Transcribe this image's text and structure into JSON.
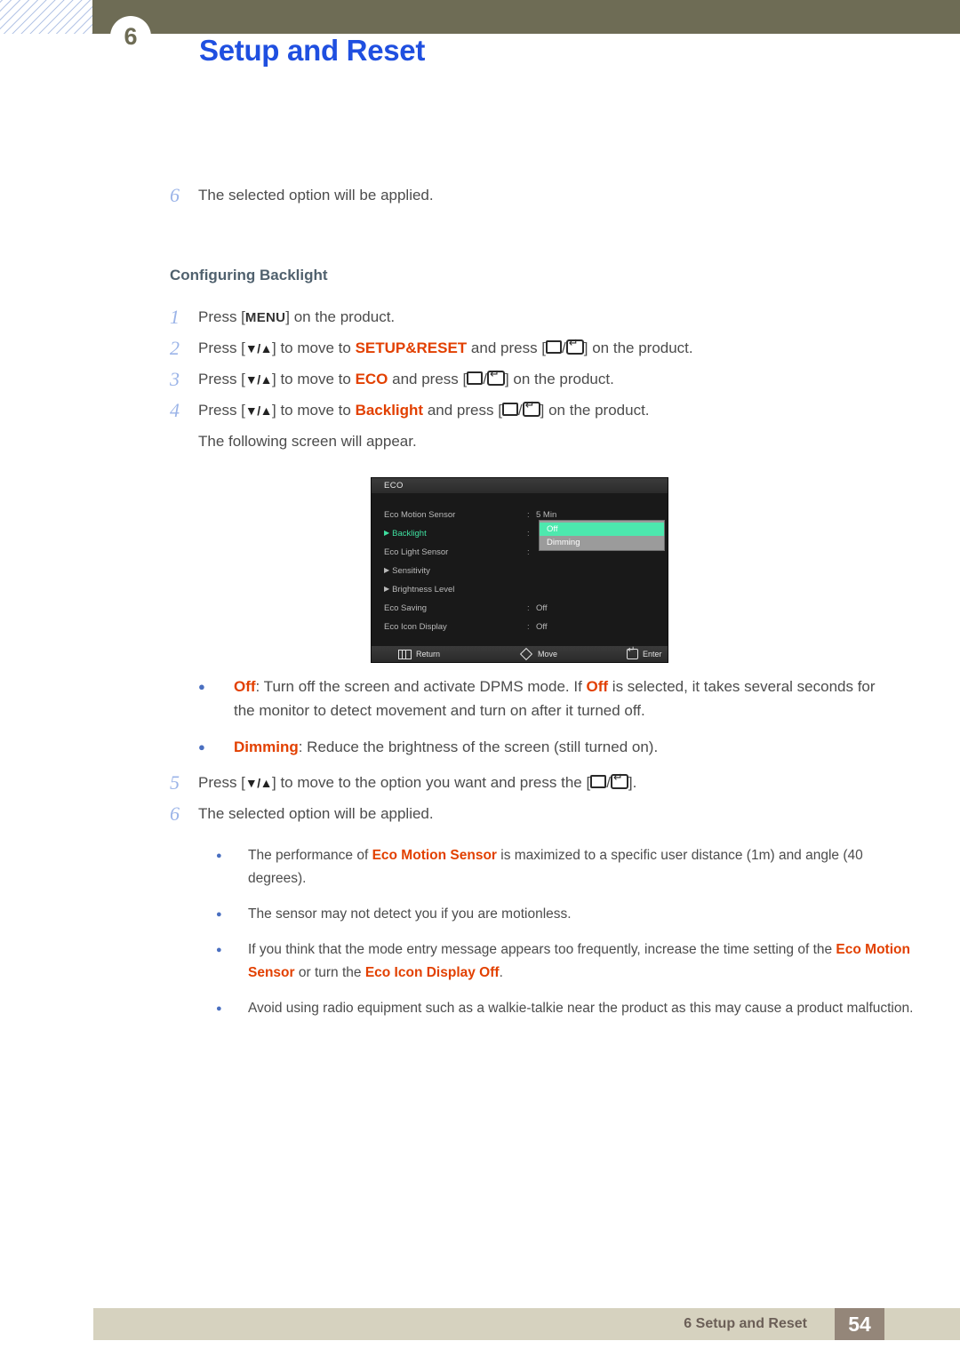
{
  "header": {
    "chapter_number": "6",
    "title": "Setup and Reset"
  },
  "intro": {
    "step_num": "6",
    "step_text": "The selected option will be applied."
  },
  "section": {
    "heading": "Configuring Backlight",
    "steps": [
      {
        "num": "1",
        "pre": "Press [",
        "key": "MENU",
        "post": "] on the product."
      },
      {
        "num": "2",
        "pre": "Press [",
        "arrows": "▼/▲",
        "mid": "] to move to ",
        "target": "SETUP&RESET",
        "post": " and press [",
        "tail": "] on the product."
      },
      {
        "num": "3",
        "pre": "Press [",
        "arrows": "▼/▲",
        "mid": "] to move to ",
        "target": "ECO",
        "post": " and press [",
        "tail": "] on the product."
      },
      {
        "num": "4",
        "pre": "Press [",
        "arrows": "▼/▲",
        "mid": "] to move to ",
        "target": "Backlight",
        "post": " and press [",
        "tail": "] on the product."
      }
    ],
    "follow_line": "The following screen will appear."
  },
  "osd": {
    "title": "ECO",
    "rows": [
      {
        "label": "Eco Motion Sensor",
        "arrow": false,
        "active": false,
        "colon": ":",
        "value": "5 Min"
      },
      {
        "label": "Backlight",
        "arrow": true,
        "active": true,
        "colon": ":",
        "value": ""
      },
      {
        "label": "Eco Light Sensor",
        "arrow": false,
        "active": false,
        "colon": ":",
        "value": ""
      },
      {
        "label": "Sensitivity",
        "arrow": true,
        "active": false,
        "colon": "",
        "value": ""
      },
      {
        "label": "Brightness Level",
        "arrow": true,
        "active": false,
        "colon": "",
        "value": ""
      },
      {
        "label": "Eco Saving",
        "arrow": false,
        "active": false,
        "colon": ":",
        "value": "Off"
      },
      {
        "label": "Eco Icon Display",
        "arrow": false,
        "active": false,
        "colon": ":",
        "value": "Off"
      }
    ],
    "dropdown": {
      "selected": "Off",
      "other": "Dimming"
    },
    "footer": {
      "return": "Return",
      "move": "Move",
      "enter": "Enter"
    },
    "colors": {
      "highlight_green": "#4de8ae",
      "label_green": "#3fe0a0",
      "dropdown_gray": "#9b9b9b",
      "panel_black": "#191919"
    }
  },
  "option_bullets": [
    {
      "term": "Off",
      "text_a": ": Turn off the screen and activate DPMS mode. If ",
      "term2": "Off",
      "text_b": " is selected, it takes several seconds for the monitor to detect movement and turn on after it turned off."
    },
    {
      "term": "Dimming",
      "text_a": ": Reduce the brightness of the screen (still turned on).",
      "term2": "",
      "text_b": ""
    }
  ],
  "closing_steps": [
    {
      "num": "5",
      "pre": "Press [",
      "arrows": "▼/▲",
      "mid": "] to move to the option you want and press the [",
      "tail": "]."
    },
    {
      "num": "6",
      "text": "The selected option will be applied."
    }
  ],
  "notes": [
    {
      "pre": "The performance of ",
      "em1": "Eco Motion Sensor",
      "mid": " is maximized to a specific user distance (1m) and angle (40 degrees).",
      "em2": "",
      "post": ""
    },
    {
      "pre": "The sensor may not detect you if you are motionless.",
      "em1": "",
      "mid": "",
      "em2": "",
      "post": ""
    },
    {
      "pre": "If you think that the mode entry message appears too frequently, increase the time setting of the ",
      "em1": "Eco Motion Sensor",
      "mid": " or turn the ",
      "em2": "Eco Icon Display Off",
      "post": "."
    },
    {
      "pre": "Avoid using radio equipment such as a walkie-talkie near the product as this may cause a product malfuction.",
      "em1": "",
      "mid": "",
      "em2": "",
      "post": ""
    }
  ],
  "footer": {
    "chapter_label": "6 Setup and Reset",
    "page_number": "54"
  },
  "accent_colors": {
    "title_blue": "#1f4fe0",
    "highlight_orange": "#e24000",
    "header_olive": "#6e6c55",
    "footer_beige": "#d6d2bf",
    "footer_brown": "#948679"
  }
}
